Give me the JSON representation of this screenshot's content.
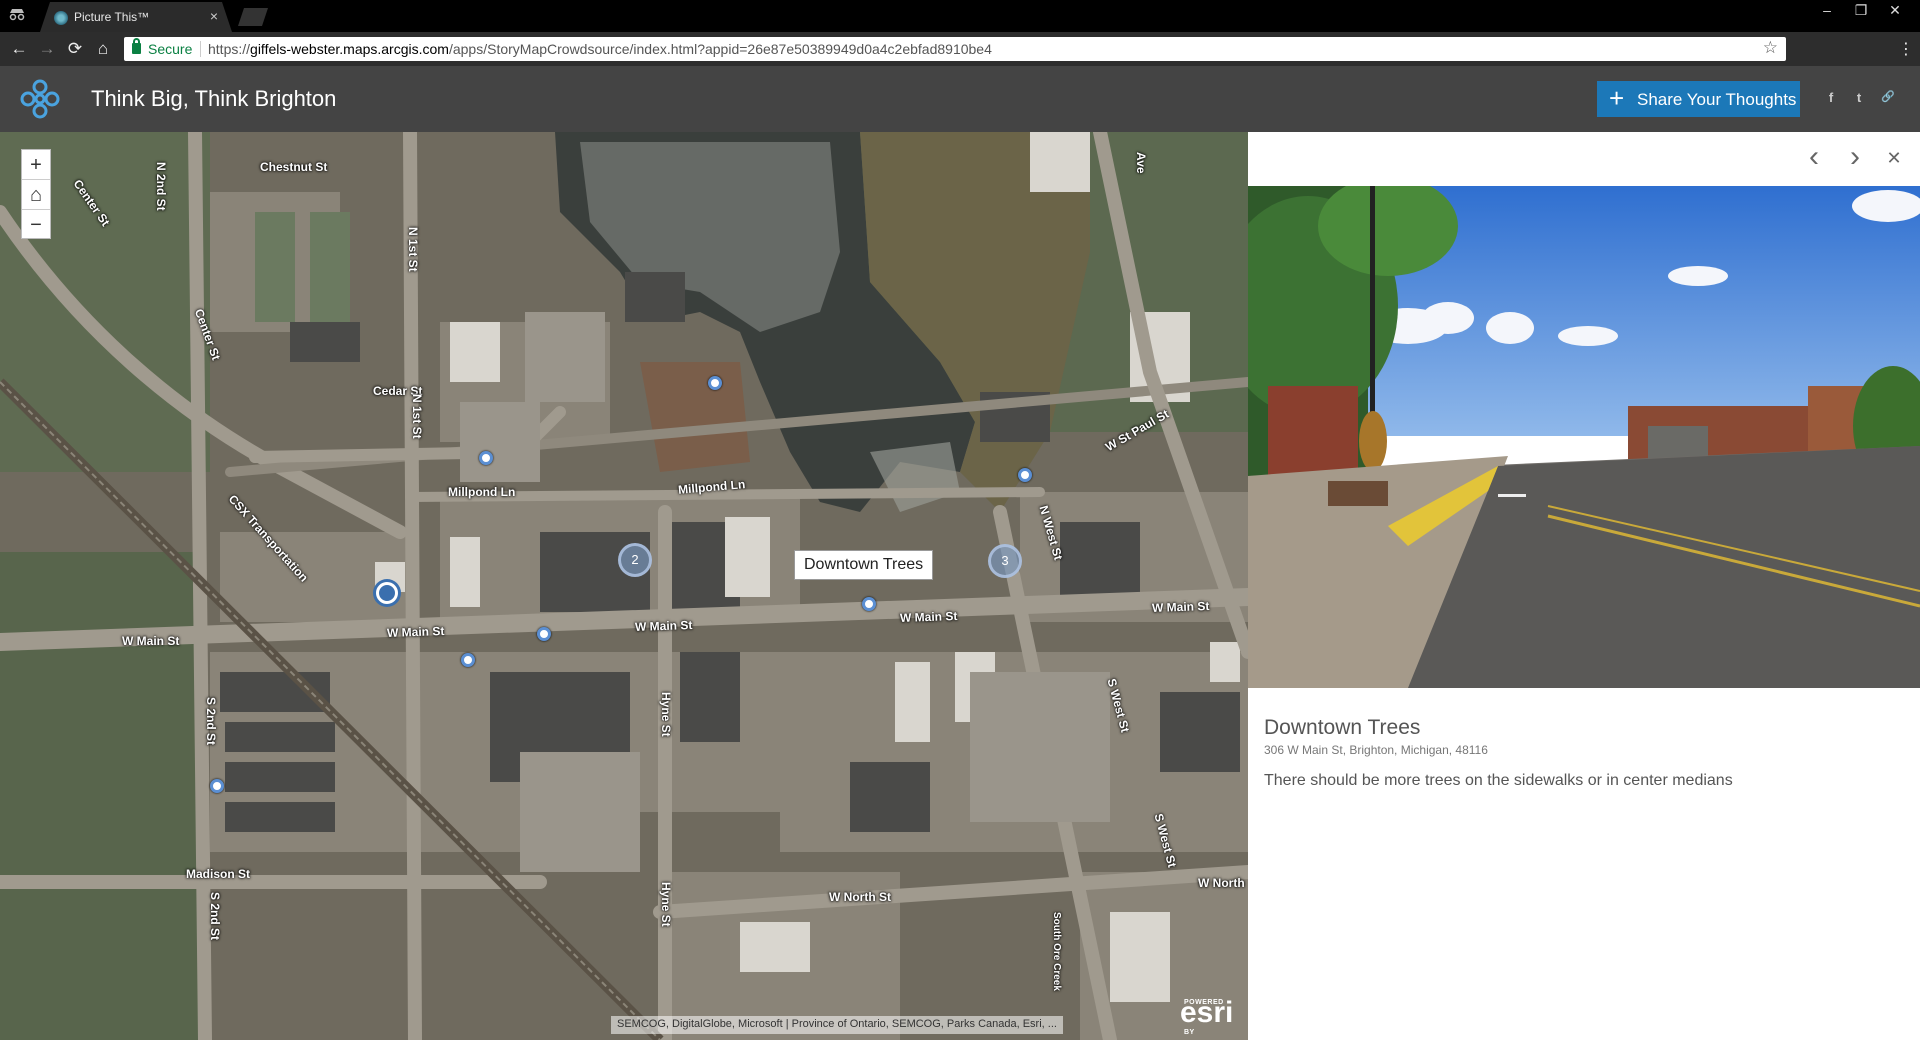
{
  "browser": {
    "tab_title": "Picture This™",
    "tab_close": "×",
    "secure_label": "Secure",
    "url_scheme": "https://",
    "url_host": "giffels-webster.maps.arcgis.com",
    "url_path": "/apps/StoryMapCrowdsource/index.html?appid=26e87e50389949d0a4c2ebfad8910be4",
    "back_icon": "←",
    "forward_icon": "→",
    "reload_icon": "⟳",
    "home_icon": "⌂",
    "star_icon": "☆",
    "menu_icon": "⋮",
    "minimize": "‒",
    "restore": "❐",
    "close": "✕"
  },
  "header": {
    "title": "Think Big, Think Brighton",
    "share_plus": "+",
    "share_label": "Share Your Thoughts",
    "social": {
      "facebook": "f",
      "twitter": "t",
      "link": "🔗"
    }
  },
  "map": {
    "zoom_in": "+",
    "zoom_home": "⌂",
    "zoom_out": "−",
    "tooltip": "Downtown Trees",
    "attribution": "SEMCOG, DigitalGlobe, Microsoft | Province of Ontario, SEMCOG, Parks Canada, Esri, ...",
    "esri_powered": "POWERED BY",
    "esri_logo": "esri",
    "clusters": [
      "2",
      "3"
    ],
    "street_labels": {
      "n2nd": "N 2nd St",
      "chestnut": "Chestnut St",
      "center1": "Center St",
      "center2": "Center St",
      "n1st_upper": "N 1st St",
      "cedar": "Cedar St",
      "n1st_lower": "N 1st St",
      "millpond1": "Millpond Ln",
      "millpond2": "Millpond Ln",
      "csx": "CSX Transportation",
      "wstpaul": "W St Paul St",
      "nwest": "N West St",
      "wmain1": "W Main St",
      "wmain2": "W Main St",
      "wmain3": "W Main St",
      "wmain4": "W Main St",
      "wmain5": "W Main St",
      "s2nd1": "S 2nd St",
      "hyne1": "Hyne St",
      "swest1": "S West St",
      "swest2": "S West St",
      "madison": "Madison St",
      "s2nd2": "S 2nd St",
      "hyne2": "Hyne St",
      "wnorth1": "W North St",
      "wnorth2": "W North",
      "southon": "South Ore Creek",
      "ave": "Ave"
    }
  },
  "panel": {
    "prev_icon": "‹",
    "next_icon": "›",
    "close_icon": "✕",
    "title": "Downtown Trees",
    "address": "306 W Main St, Brighton, Michigan, 48116",
    "description": "There should be more trees on the sidewalks or in center medians"
  },
  "colors": {
    "header_bg": "#444444",
    "share_button": "#1c78b8",
    "pin_ring": "#5b8fd3",
    "secure_green": "#0b8043"
  }
}
